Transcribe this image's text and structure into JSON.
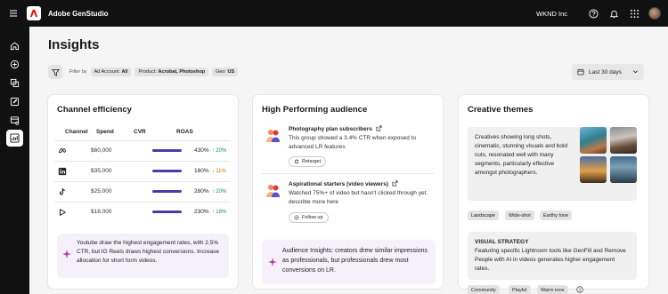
{
  "app": {
    "title": "Adobe GenStudio",
    "org": "WKND Inc"
  },
  "page": {
    "title": "Insights"
  },
  "filters": {
    "label": "Filter by",
    "chips": [
      {
        "key": "Ad Account:",
        "value": "All"
      },
      {
        "key": "Product:",
        "value": "Acrobat, Photoshop"
      },
      {
        "key": "Geo:",
        "value": "US"
      }
    ],
    "date_range": "Last 30 days"
  },
  "channel_efficiency": {
    "title": "Channel efficiency",
    "headers": {
      "channel": "Channel",
      "spend": "Spend",
      "cvr": "CVR",
      "roas": "ROAS"
    },
    "rows": [
      {
        "channel_icon": "meta-icon",
        "spend": "$60,000",
        "cvr_fill": 1.0,
        "roas": "430%",
        "change": "↑ 20%",
        "direction": "up"
      },
      {
        "channel_icon": "linkedin-icon",
        "spend": "$35,000",
        "cvr_fill": 1.0,
        "roas": "160%",
        "change": "↓ 11%",
        "direction": "down"
      },
      {
        "channel_icon": "tiktok-icon",
        "spend": "$25,000",
        "cvr_fill": 1.0,
        "roas": "280%",
        "change": "↑ 20%",
        "direction": "up"
      },
      {
        "channel_icon": "youtube-icon",
        "spend": "$18,000",
        "cvr_fill": 1.0,
        "roas": "230%",
        "change": "↑ 18%",
        "direction": "up"
      }
    ],
    "insight": "Youtube draw the highest engagement rates, with 2.5% CTR, but IG Reels draws highest conversions. Increase allocation for short form videos."
  },
  "audience": {
    "title": "High Performing audience",
    "items": [
      {
        "name": "Photography plan subscribers",
        "description": "This group showed a 3.4% CTR when exposed to advanced LR features",
        "action": "Retarget"
      },
      {
        "name": "Aspirational starters (video viewers)",
        "description": "Watched 75%+ of video but hasn't clicked through yet. describe more here",
        "action": "Follow up"
      }
    ],
    "insight": "Audience Insights: creators drew similar impressions as professionals, but professionals drew most conversions on LR."
  },
  "creative": {
    "title": "Creative themes",
    "theme_text": "Creatives showing long shots, cinematic, stunning visuals  and bold cuts, resonated well with many segments, particularly effective amongst photographers.",
    "theme_tags": [
      "Landscape",
      "Wide-shot",
      "Earthy tone"
    ],
    "strategy_heading": "VISUAL STRATEGY",
    "strategy_text": "Featuring specific Lightroom tools like GenFill and Remove People  with AI in videos generates higher engagement rates.",
    "strategy_tags": [
      "Community",
      "Playful",
      "Warm tone"
    ]
  },
  "colors": {
    "accent": "#4b3aa8",
    "up": "#1a8f4e",
    "down": "#d4700f",
    "topbar": "#111111",
    "adobe_red": "#eb1000"
  }
}
